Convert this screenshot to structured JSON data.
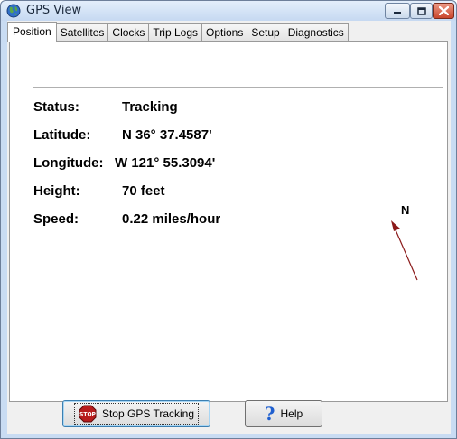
{
  "window": {
    "title": "GPS View",
    "accent": "#c9dcf3",
    "close_color": "#c9462c"
  },
  "tabs": [
    {
      "label": "Position",
      "active": true
    },
    {
      "label": "Satellites",
      "active": false
    },
    {
      "label": "Clocks",
      "active": false
    },
    {
      "label": "Trip Logs",
      "active": false
    },
    {
      "label": "Options",
      "active": false
    },
    {
      "label": "Setup",
      "active": false
    },
    {
      "label": "Diagnostics",
      "active": false
    }
  ],
  "position": {
    "status_label": "Status:",
    "status_value": "Tracking",
    "latitude_label": "Latitude:",
    "latitude_value": "N 36° 37.4587'",
    "longitude_label": "Longitude:",
    "longitude_value": "W 121° 55.3094'",
    "height_label": "Height:",
    "height_value": "70 feet",
    "speed_label": "Speed:",
    "speed_value": "0.22 miles/hour"
  },
  "compass": {
    "north_label": "N",
    "arrow_color": "#8b1a1a"
  },
  "buttons": {
    "stop_label": "Stop GPS Tracking",
    "help_label": "Help"
  },
  "icons": {
    "app": "globe-icon",
    "stop": "stop-sign-icon",
    "help": "question-mark-icon"
  }
}
